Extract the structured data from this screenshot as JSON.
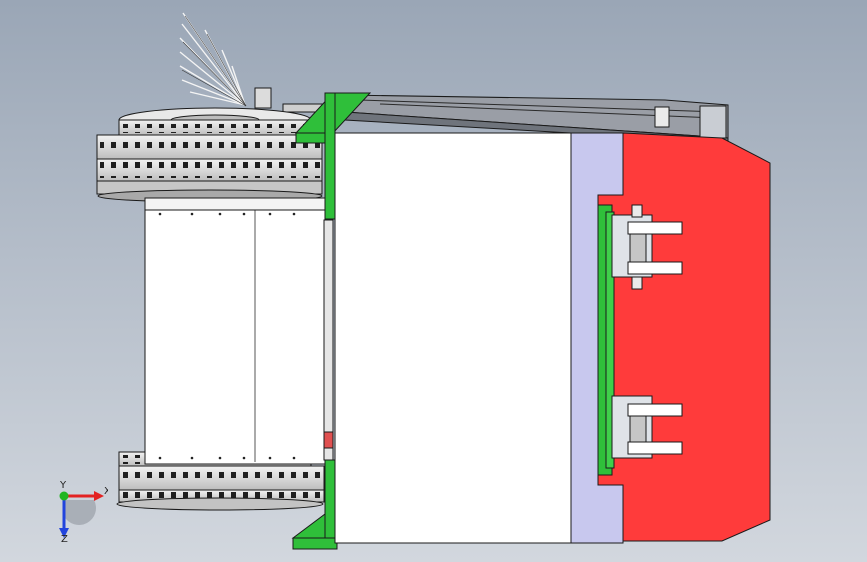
{
  "viewport": {
    "background_top": "#9aa6b6",
    "background_bottom": "#d2d7de"
  },
  "colors": {
    "frame_green": "#2fbf3a",
    "red_plate": "#ff3b3b",
    "lavender_plate": "#c8c8ee",
    "white_body": "#ffffff",
    "edge": "#1a1a1a",
    "grey_part": "#d8dce2"
  },
  "triad": {
    "x_label": "X",
    "y_label": "Y",
    "z_label": "Z",
    "x_color": "#e32222",
    "y_color": "#22b522",
    "z_color": "#2244dd",
    "icon": "coordinate-triad-icon"
  }
}
